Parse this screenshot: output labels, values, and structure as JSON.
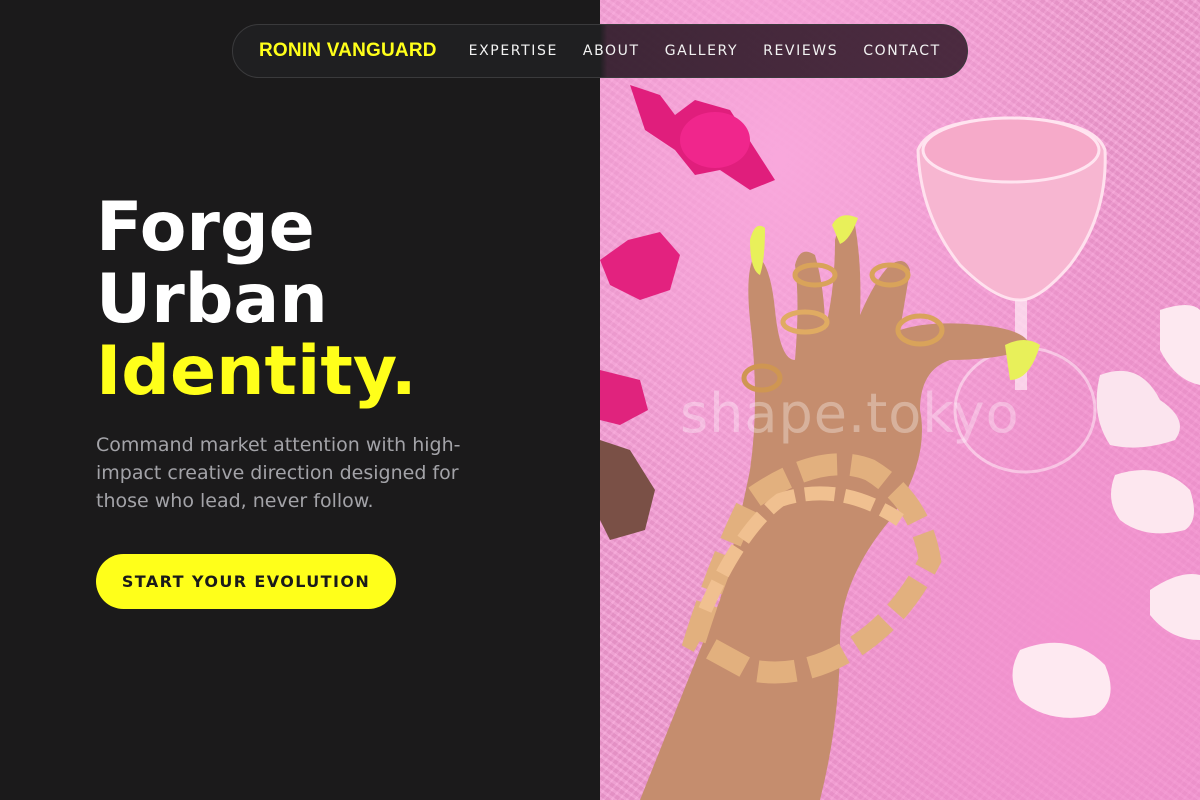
{
  "nav": {
    "brand": "RONIN VANGUARD",
    "links": [
      "EXPERTISE",
      "ABOUT",
      "GALLERY",
      "REVIEWS",
      "CONTACT"
    ]
  },
  "hero": {
    "title_line1": "Forge",
    "title_line2": "Urban",
    "title_line3": "Identity.",
    "subtitle": "Command market attention with high-impact creative direction designed for those who lead, never follow.",
    "cta_label": "START YOUR EVOLUTION"
  },
  "image": {
    "watermark": "shape.tokyo",
    "description_icons": [
      "hand-with-gold-jewelry",
      "cocktail-glass",
      "candy",
      "rose-petals"
    ]
  },
  "colors": {
    "accent": "#ffff1a",
    "dark_bg": "#1b1a1b",
    "image_bg": "#f49bd3"
  }
}
